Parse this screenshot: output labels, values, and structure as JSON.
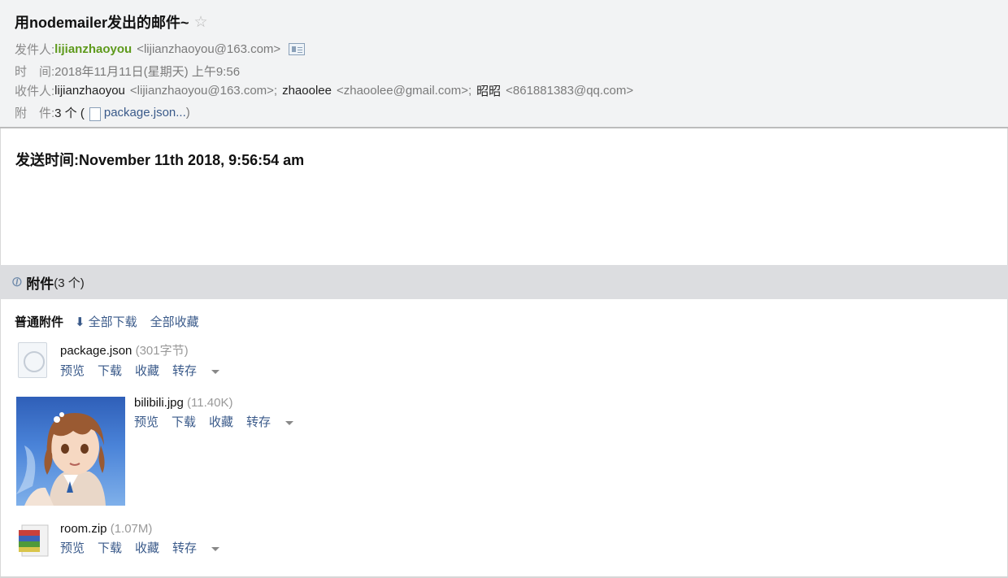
{
  "email": {
    "subject": "用nodemailer发出的邮件~",
    "star_icon": "☆",
    "from_label": "发件人:",
    "from_name": "lijianzhaoyou",
    "from_addr": "<lijianzhaoyou@163.com>",
    "time_label": "时　间:",
    "time_value": "2018年11月11日(星期天) 上午9:56",
    "to_label": "收件人:",
    "to_1_name": "lijianzhaoyou",
    "to_1_addr": "<lijianzhaoyou@163.com>;",
    "to_2_name": "zhaoolee",
    "to_2_addr": "<zhaoolee@gmail.com>;",
    "to_3_name": "昭昭",
    "to_3_addr": "<861881383@qq.com>",
    "att_label": "附　件:",
    "att_count": "3 个 (",
    "att_first": "package.json...",
    "att_close": ")"
  },
  "body": {
    "send_time": "发送时间:November 11th 2018, 9:56:54 am"
  },
  "attachments": {
    "title": "附件",
    "count": "(3 个)",
    "normal_label": "普通附件",
    "download_all": "全部下载",
    "collect_all": "全部收藏",
    "files": [
      {
        "name": "package.json",
        "size": "(301字节)",
        "icon": "file-icon"
      },
      {
        "name": "bilibili.jpg",
        "size": "(11.40K)",
        "icon": "image-thumbnail"
      },
      {
        "name": "room.zip",
        "size": "(1.07M)",
        "icon": "archive-icon"
      }
    ],
    "actions": {
      "preview": "预览",
      "download": "下载",
      "collect": "收藏",
      "save_to": "转存"
    }
  }
}
